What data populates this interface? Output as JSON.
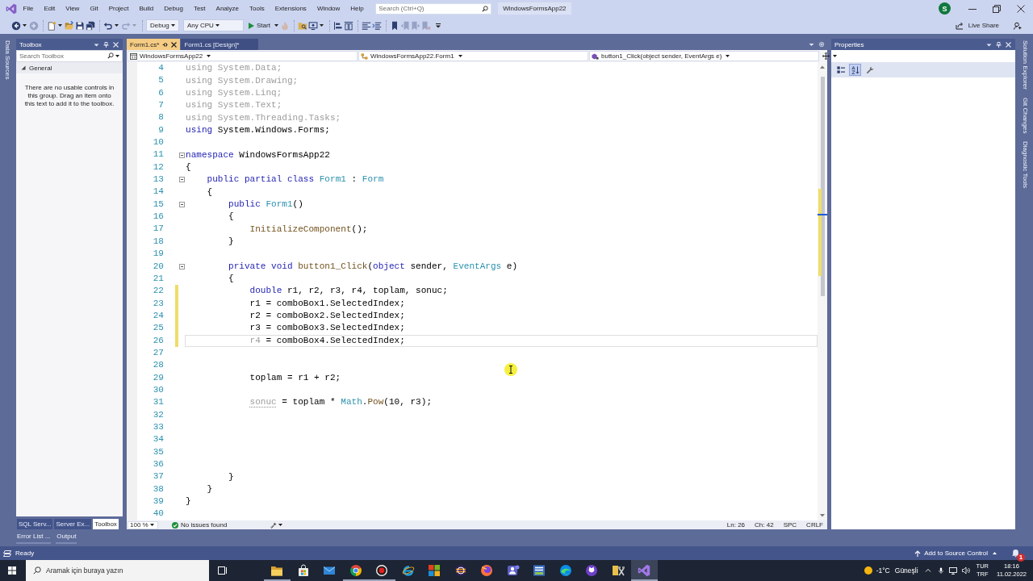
{
  "window": {
    "title": "WindowsFormsApp22",
    "account_initial": "S"
  },
  "menu": [
    "File",
    "Edit",
    "View",
    "Git",
    "Project",
    "Build",
    "Debug",
    "Test",
    "Analyze",
    "Tools",
    "Extensions",
    "Window",
    "Help"
  ],
  "search": {
    "placeholder": "Search (Ctrl+Q)"
  },
  "toolbar": {
    "nav_buttons": [
      {
        "disabled": false,
        "dropdown": true
      },
      {
        "disabled": true,
        "dropdown": false
      },
      {
        "disabled": false,
        "dropdown": true
      },
      {
        "disabled": false,
        "dropdown": false
      },
      {
        "disabled": false,
        "dropdown": false
      },
      {
        "disabled": false,
        "dropdown": false
      },
      {
        "disabled": false,
        "dropdown": true
      },
      {
        "disabled": true,
        "dropdown": true
      }
    ],
    "configuration": "Debug",
    "platform": "Any CPU",
    "start": "Start",
    "tool_buttons": [
      {
        "disabled": true,
        "dropdown": false
      },
      {
        "disabled": false,
        "dropdown": false
      },
      {
        "disabled": false,
        "dropdown": true
      },
      {
        "disabled": false,
        "dropdown": false
      },
      {
        "disabled": false,
        "dropdown": false
      },
      {
        "disabled": false,
        "dropdown": false
      },
      {
        "disabled": false,
        "dropdown": false
      },
      {
        "disabled": false,
        "dropdown": false
      },
      {
        "disabled": true,
        "dropdown": false
      },
      {
        "disabled": true,
        "dropdown": false
      },
      {
        "disabled": true,
        "dropdown": false
      }
    ],
    "live_share": "Live Share"
  },
  "left_dock_tabs": [
    "Data Sources"
  ],
  "toolbox": {
    "title": "Toolbox",
    "search": {
      "placeholder": "Search Toolbox"
    },
    "group": {
      "label": "General",
      "expanded": true
    },
    "message": "There are no usable controls in this group. Drag an item onto this text to add it to the toolbox."
  },
  "left_tabs": [
    {
      "label": "SQL Serv...",
      "selected": false
    },
    {
      "label": "Server Ex...",
      "selected": false
    },
    {
      "label": "Toolbox",
      "selected": true
    }
  ],
  "editor": {
    "tabs": [
      {
        "label": "Form1.cs*",
        "selected": true
      },
      {
        "label": "Form1.cs [Design]*",
        "selected": false
      }
    ],
    "navigation": [
      {
        "kind": "project",
        "text": "WindowsFormsApp22"
      },
      {
        "kind": "class",
        "text": "WindowsFormsApp22.Form1"
      },
      {
        "kind": "method",
        "text": "button1_Click(object sender, EventArgs e)"
      }
    ],
    "lines": [
      {
        "number": "4",
        "tokens": [
          {
            "kind": "faded",
            "text": "using System.Data;"
          }
        ],
        "changed": false,
        "current": false,
        "collapsible": false
      },
      {
        "number": "5",
        "tokens": [
          {
            "kind": "faded",
            "text": "using System.Drawing;"
          }
        ],
        "changed": false,
        "current": false,
        "collapsible": false
      },
      {
        "number": "6",
        "tokens": [
          {
            "kind": "faded",
            "text": "using System.Linq;"
          }
        ],
        "changed": false,
        "current": false,
        "collapsible": false
      },
      {
        "number": "7",
        "tokens": [
          {
            "kind": "faded",
            "text": "using System.Text;"
          }
        ],
        "changed": false,
        "current": false,
        "collapsible": false
      },
      {
        "number": "8",
        "tokens": [
          {
            "kind": "faded",
            "text": "using System.Threading.Tasks;"
          }
        ],
        "changed": false,
        "current": false,
        "collapsible": false
      },
      {
        "number": "9",
        "tokens": [
          {
            "kind": "keyword",
            "text": "using"
          },
          {
            "kind": "plain",
            "text": " System.Windows.Forms;"
          }
        ],
        "changed": false,
        "current": false,
        "collapsible": false
      },
      {
        "number": "10",
        "changed": false,
        "current": false,
        "collapsible": false
      },
      {
        "number": "11",
        "tokens": [
          {
            "kind": "keyword",
            "text": "namespace"
          },
          {
            "kind": "plain",
            "text": " WindowsFormsApp22"
          }
        ],
        "changed": false,
        "current": false,
        "collapsible": true
      },
      {
        "number": "12",
        "tokens": [
          {
            "kind": "plain",
            "text": "{"
          }
        ],
        "changed": false,
        "current": false,
        "collapsible": false
      },
      {
        "number": "13",
        "tokens": [
          {
            "kind": "keyword",
            "text": "    public partial class"
          },
          {
            "kind": "type",
            "text": " Form1"
          },
          {
            "kind": "plain",
            "text": " : "
          },
          {
            "kind": "type",
            "text": "Form"
          }
        ],
        "changed": false,
        "current": false,
        "collapsible": true
      },
      {
        "number": "14",
        "tokens": [
          {
            "kind": "plain",
            "text": "    {"
          }
        ],
        "changed": false,
        "current": false,
        "collapsible": false
      },
      {
        "number": "15",
        "tokens": [
          {
            "kind": "keyword",
            "text": "        public"
          },
          {
            "kind": "type",
            "text": " Form1"
          },
          {
            "kind": "plain",
            "text": "()"
          }
        ],
        "changed": false,
        "current": false,
        "collapsible": true
      },
      {
        "number": "16",
        "tokens": [
          {
            "kind": "plain",
            "text": "        {"
          }
        ],
        "changed": false,
        "current": false,
        "collapsible": false
      },
      {
        "number": "17",
        "tokens": [
          {
            "kind": "method",
            "text": "            InitializeComponent"
          },
          {
            "kind": "plain",
            "text": "();"
          }
        ],
        "changed": false,
        "current": false,
        "collapsible": false
      },
      {
        "number": "18",
        "tokens": [
          {
            "kind": "plain",
            "text": "        }"
          }
        ],
        "changed": false,
        "current": false,
        "collapsible": false
      },
      {
        "number": "19",
        "changed": false,
        "current": false,
        "collapsible": false
      },
      {
        "number": "20",
        "tokens": [
          {
            "kind": "keyword",
            "text": "        private void"
          },
          {
            "kind": "method",
            "text": " button1_Click"
          },
          {
            "kind": "plain",
            "text": "("
          },
          {
            "kind": "keyword",
            "text": "object"
          },
          {
            "kind": "plain",
            "text": " sender, "
          },
          {
            "kind": "type",
            "text": "EventArgs"
          },
          {
            "kind": "plain",
            "text": " e)"
          }
        ],
        "changed": false,
        "current": false,
        "collapsible": true
      },
      {
        "number": "21",
        "tokens": [
          {
            "kind": "plain",
            "text": "        {"
          }
        ],
        "changed": false,
        "current": false,
        "collapsible": false
      },
      {
        "number": "22",
        "tokens": [
          {
            "kind": "keyword",
            "text": "            double"
          },
          {
            "kind": "plain",
            "text": " r1, r2, r3, r4, toplam, sonuc;"
          }
        ],
        "changed": true,
        "current": false,
        "collapsible": false
      },
      {
        "number": "23",
        "tokens": [
          {
            "kind": "plain",
            "text": "            r1 = comboBox1.SelectedIndex;"
          }
        ],
        "changed": true,
        "current": false,
        "collapsible": false
      },
      {
        "number": "24",
        "tokens": [
          {
            "kind": "plain",
            "text": "            r2 = comboBox2.SelectedIndex;"
          }
        ],
        "changed": true,
        "current": false,
        "collapsible": false
      },
      {
        "number": "25",
        "tokens": [
          {
            "kind": "plain",
            "text": "            r3 = comboBox3.SelectedIndex;"
          }
        ],
        "changed": true,
        "current": false,
        "collapsible": false
      },
      {
        "number": "26",
        "tokens": [
          {
            "kind": "faded",
            "text": "            r4"
          },
          {
            "kind": "plain",
            "text": " = comboBox4.SelectedIndex;"
          }
        ],
        "changed": true,
        "current": true,
        "collapsible": false
      },
      {
        "number": "27",
        "changed": false,
        "current": false,
        "collapsible": false
      },
      {
        "number": "28",
        "changed": false,
        "current": false,
        "collapsible": false
      },
      {
        "number": "29",
        "tokens": [
          {
            "kind": "plain",
            "text": "            toplam = r1 + r2;"
          }
        ],
        "changed": false,
        "current": false,
        "collapsible": false
      },
      {
        "number": "30",
        "changed": false,
        "current": false,
        "collapsible": false
      },
      {
        "number": "31",
        "tokens": [
          {
            "kind": "hint",
            "text": "            sonuc"
          },
          {
            "kind": "plain",
            "text": " = toplam * "
          },
          {
            "kind": "type",
            "text": "Math"
          },
          {
            "kind": "plain",
            "text": "."
          },
          {
            "kind": "method",
            "text": "Pow"
          },
          {
            "kind": "plain",
            "text": "(10, r3);"
          }
        ],
        "changed": false,
        "current": false,
        "collapsible": false
      },
      {
        "number": "32",
        "changed": false,
        "current": false,
        "collapsible": false
      },
      {
        "number": "33",
        "changed": false,
        "current": false,
        "collapsible": false
      },
      {
        "number": "34",
        "changed": false,
        "current": false,
        "collapsible": false
      },
      {
        "number": "35",
        "changed": false,
        "current": false,
        "collapsible": false
      },
      {
        "number": "36",
        "changed": false,
        "current": false,
        "collapsible": false
      },
      {
        "number": "37",
        "tokens": [
          {
            "kind": "plain",
            "text": "        }"
          }
        ],
        "changed": false,
        "current": false,
        "collapsible": false
      },
      {
        "number": "38",
        "tokens": [
          {
            "kind": "plain",
            "text": "    }"
          }
        ],
        "changed": false,
        "current": false,
        "collapsible": false
      },
      {
        "number": "39",
        "tokens": [
          {
            "kind": "plain",
            "text": "}"
          }
        ],
        "changed": false,
        "current": false,
        "collapsible": false
      },
      {
        "number": "40",
        "changed": false,
        "current": false,
        "collapsible": false
      }
    ],
    "status": {
      "zoom": "100 %",
      "issues": "No issues found",
      "line": "Ln: 26",
      "column": "Ch: 42",
      "indentation": "SPC",
      "line_endings": "CRLF"
    }
  },
  "properties": {
    "title": "Properties",
    "view_buttons": [
      {
        "selected": false
      },
      {
        "selected": true
      },
      {
        "selected": false
      }
    ]
  },
  "right_dock_tabs": [
    "Solution Explorer",
    "Git Changes",
    "Diagnostic Tools"
  ],
  "bottom_tabs": [
    "Error List ...",
    "Output"
  ],
  "status_bar": {
    "text": "Ready",
    "source_control": "Add to Source Control",
    "notification_count": "1"
  },
  "taskbar": {
    "search_placeholder": "Aramak için buraya yazın",
    "apps": [
      {
        "running": true,
        "active": false
      },
      {
        "running": false,
        "active": false
      },
      {
        "running": false,
        "active": false
      },
      {
        "running": true,
        "active": false
      },
      {
        "running": true,
        "active": false
      },
      {
        "running": false,
        "active": false
      },
      {
        "running": false,
        "active": false
      },
      {
        "running": false,
        "active": false
      },
      {
        "running": false,
        "active": false
      },
      {
        "running": false,
        "active": false
      },
      {
        "running": false,
        "active": false
      },
      {
        "running": false,
        "active": false
      },
      {
        "running": false,
        "active": false
      },
      {
        "running": false,
        "active": false
      },
      {
        "running": true,
        "active": true
      }
    ],
    "weather": {
      "temperature": "-1°C",
      "condition": "Güneşli"
    },
    "input_language": "TUR",
    "keyboard_layout": "TRF",
    "time": "18:16",
    "date": "11.02.2022"
  }
}
